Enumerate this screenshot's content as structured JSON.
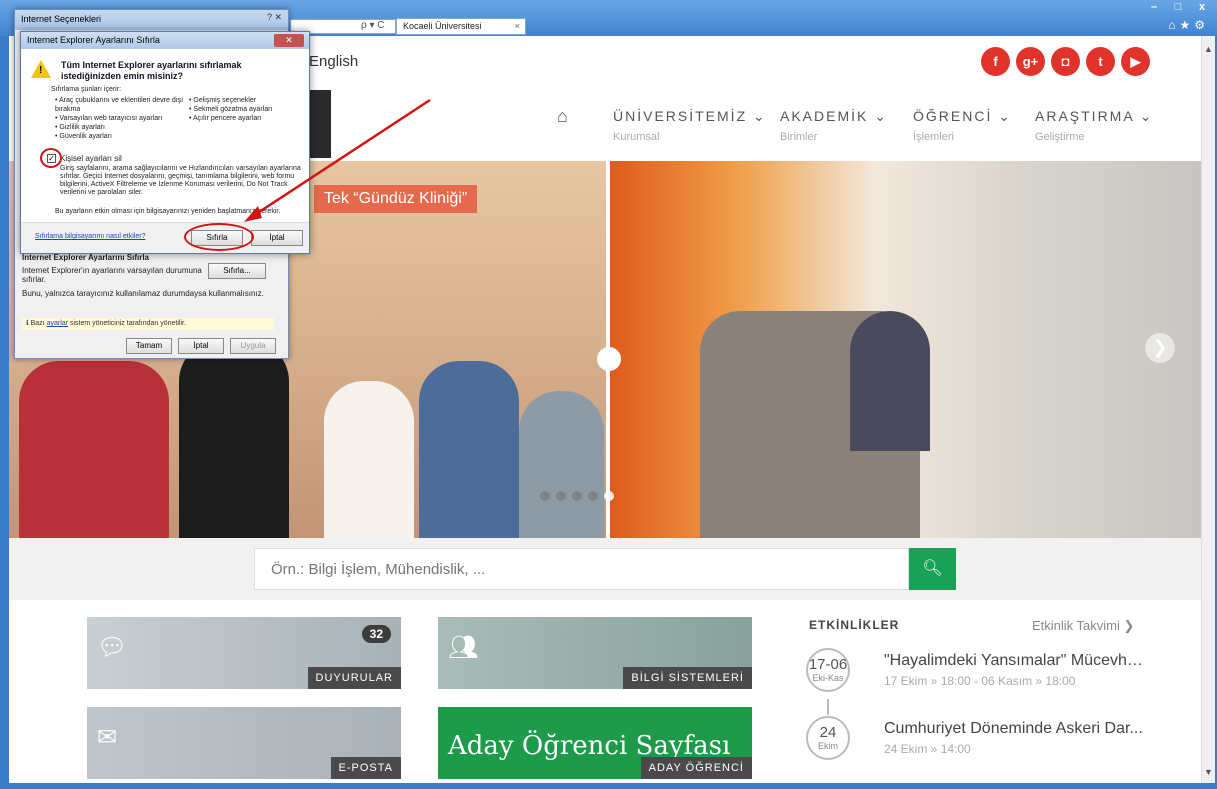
{
  "browser": {
    "tab_title": "Kocaeli Üniversitesi",
    "tab_close": "×",
    "address_controls": "ρ ▾ C",
    "window_controls": [
      "–",
      "□",
      "x"
    ],
    "tool_icons": [
      "home-icon",
      "star-icon",
      "gear-icon"
    ]
  },
  "page": {
    "language_link": "English",
    "social": [
      {
        "icon": "facebook-icon",
        "glyph": "f",
        "color": "#e0332b"
      },
      {
        "icon": "googleplus-icon",
        "glyph": "g+",
        "color": "#e0332b"
      },
      {
        "icon": "instagram-icon",
        "glyph": "◘",
        "color": "#e0332b"
      },
      {
        "icon": "twitter-icon",
        "glyph": "t",
        "color": "#e0332b"
      },
      {
        "icon": "youtube-icon",
        "glyph": "▶",
        "color": "#e0332b"
      }
    ],
    "nav": [
      {
        "title": "ÜNİVERSİTEMİZ ⌄",
        "sub": "Kurumsal"
      },
      {
        "title": "AKADEMİK ⌄",
        "sub": "Birimler"
      },
      {
        "title": "ÖĞRENCİ ⌄",
        "sub": "İşlemleri"
      },
      {
        "title": "ARAŞTIRMA ⌄",
        "sub": "Geliştirme"
      }
    ],
    "slide_caption": "Tek “Gündüz Kliniği”",
    "search": {
      "placeholder": "Örn.: Bilgi İşlem, Mühendislik, ...",
      "button_icon": "search-icon"
    },
    "tiles": [
      {
        "label": "DUYURULAR",
        "badge": "32",
        "icon": "chat-bubble-icon",
        "color": "#b8c2c8"
      },
      {
        "label": "BİLGİ SİSTEMLERİ",
        "icon": "users-icon",
        "color": "#9fb4b0"
      },
      {
        "label": "E-POSTA",
        "icon": "envelope-icon",
        "color": "#b6bec4"
      },
      {
        "label": "ADAY ÖĞRENCİ",
        "text": "Aday Öğrenci Sayfası",
        "color": "#1d9a4a"
      }
    ],
    "events": {
      "heading": "ETKİNLİKLER",
      "link": "Etkinlik Takvimi ❯",
      "items": [
        {
          "day": "17-06",
          "month": "Eki-Kas",
          "title": "\"Hayalimdeki Yansımalar\" Mücevhe...",
          "time": "17 Ekim » 18:00 - 06 Kasım » 18:00"
        },
        {
          "day": "24",
          "month": "Ekim",
          "title": "Cumhuriyet Döneminde Askeri Dar...",
          "time": "24 Ekim » 14:00"
        }
      ]
    }
  },
  "dialog_back": {
    "title": "Internet Seçenekleri",
    "title_controls": "?   ✕",
    "group_title": "Internet Explorer Ayarlarını Sıfırla",
    "group_text_1": "Internet Explorer'ın ayarlarını varsayılan durumuna sıfırlar.",
    "group_text_2": "Bunu, yalnızca tarayıcınız kullanılamaz durumdaysa kullanmalısınız.",
    "reset_button": "Sıfırla...",
    "info_link": "ayarlar",
    "info_before": "Bazı",
    "info_after": "sistem yöneticiniz tarafından yönetilir.",
    "ok": "Tamam",
    "cancel": "İptal",
    "apply": "Uygula"
  },
  "dialog_front": {
    "title": "Internet Explorer Ayarlarını Sıfırla",
    "close": "✕",
    "question": "Tüm Internet Explorer ayarlarını sıfırlamak istediğinizden emin misiniz?",
    "list_heading": "Sıfırlama şunları içerir:",
    "list_left": [
      "Araç çubuklarını ve eklentileri devre dışı bırakma",
      "Varsayılan web tarayıcısı ayarları",
      "Gizlilik ayarları",
      "Güvenlik ayarları"
    ],
    "list_right": [
      "Gelişmiş seçenekler",
      "Sekmeli gözatma ayarları",
      "Açılır pencere ayarları"
    ],
    "checkbox_label": "Kişisel ayarları sil",
    "checkbox_mark": "✓",
    "description": "Giriş sayfalarını, arama sağlayıcılarını ve Hızlandırıcıları varsayılan ayarlarına sıfırlar. Geçici Internet dosyalarını, geçmişi, tanımlama bilgilerini, web formu bilgilerini, ActiveX Filtreleme ve İzlenme Koruması verilerini, Do Not Track verilerini ve parolaları siler.",
    "note": "Bu ayarların etkin olması için bilgisayarınızı yeniden başlatmanız gerekir.",
    "help_link": "Sıfırlama bilgisayarımı nasıl etkiler?",
    "reset": "Sıfırla",
    "cancel": "İptal"
  }
}
